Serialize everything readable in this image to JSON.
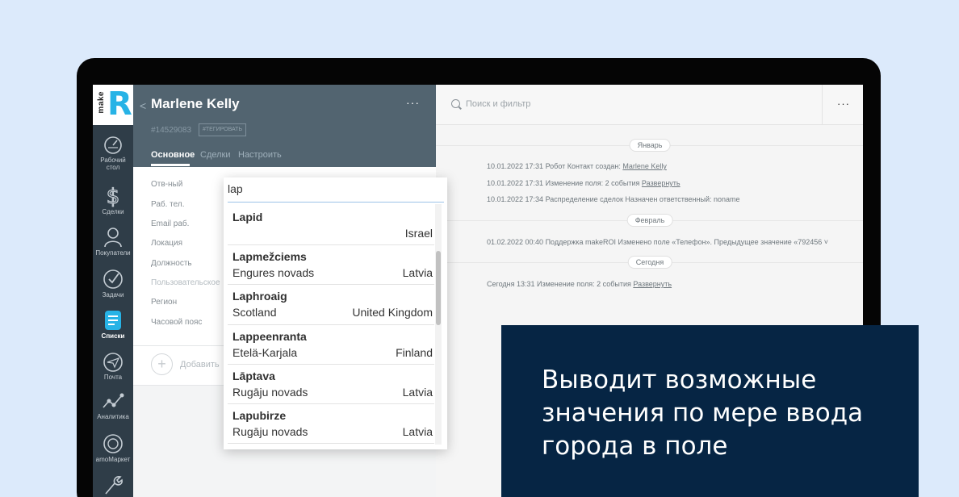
{
  "logo": {
    "text_make": "make",
    "text_r": "R"
  },
  "nav": [
    {
      "label": "Рабочий стол",
      "icon": "dashboard-icon"
    },
    {
      "label": "Сделки",
      "icon": "deals-icon"
    },
    {
      "label": "Покупатели",
      "icon": "customers-icon"
    },
    {
      "label": "Задачи",
      "icon": "tasks-icon"
    },
    {
      "label": "Списки",
      "icon": "lists-icon"
    },
    {
      "label": "Почта",
      "icon": "mail-icon"
    },
    {
      "label": "Аналитика",
      "icon": "analytics-icon"
    },
    {
      "label": "amoМаркет",
      "icon": "market-icon"
    }
  ],
  "contact": {
    "back": "<",
    "name": "Marlene Kelly",
    "menu": "···",
    "id": "#14529083",
    "tag_button": "#ТЕГИРОВАТЬ",
    "tabs": [
      "Основное",
      "Сделки",
      "Настроить"
    ],
    "fields": [
      "Отв-ный",
      "Раб. тел.",
      "Email раб.",
      "Локация",
      "Должность",
      "Пользовательское",
      "Регион",
      "Часовой пояс"
    ],
    "add_label": "Добавить",
    "add_plus": "+"
  },
  "feed": {
    "search_placeholder": "Поиск и фильтр",
    "menu": "···",
    "groups": [
      {
        "date": "Январь"
      },
      {
        "date": "Февраль"
      },
      {
        "date": "Сегодня"
      }
    ],
    "entries": [
      {
        "text": "10.01.2022 17:31 Робот Контакт создан: ",
        "link": "Marlene Kelly"
      },
      {
        "text": "10.01.2022 17:31 Изменение поля: 2 события ",
        "link": "Развернуть"
      },
      {
        "text": "10.01.2022 17:34 Распределение сделок Назначен ответственный: noname",
        "link": ""
      },
      {
        "text": "01.02.2022 00:40 Поддержка makeROI Изменено поле «Телефон». Предыдущее значение «792456 ˅",
        "link": ""
      },
      {
        "text": "Сегодня 13:31 Изменение поля: 2 события ",
        "link": "Развернуть"
      }
    ]
  },
  "dropdown": {
    "query": "lap",
    "items": [
      {
        "city": "Lapid",
        "region": "",
        "country": "Israel"
      },
      {
        "city": "Lapmežciems",
        "region": "Engures novads",
        "country": "Latvia"
      },
      {
        "city": "Laphroaig",
        "region": "Scotland",
        "country": "United Kingdom"
      },
      {
        "city": "Lappeenranta",
        "region": "Etelä-Karjala",
        "country": "Finland"
      },
      {
        "city": "Lāptava",
        "region": "Rugāju novads",
        "country": "Latvia"
      },
      {
        "city": "Lapubirze",
        "region": "Rugāju novads",
        "country": "Latvia"
      }
    ]
  },
  "caption": "Выводит возможные значения по мере ввода города в поле",
  "colors": {
    "accent": "#27b3e6",
    "nav_bg": "#2f3d48",
    "header_bg": "#526470",
    "caption_bg": "#062544",
    "page_bg": "#dceafb"
  }
}
